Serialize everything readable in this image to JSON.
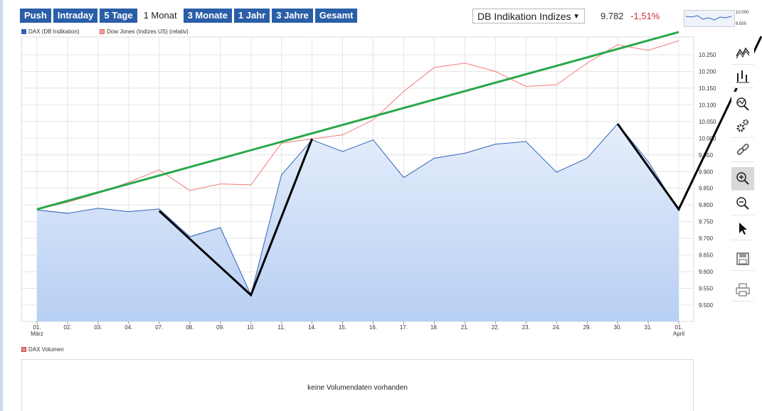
{
  "tabs": [
    {
      "label": "Push",
      "active": false
    },
    {
      "label": "Intraday",
      "active": false
    },
    {
      "label": "5 Tage",
      "active": false
    },
    {
      "label": "1 Monat",
      "active": true
    },
    {
      "label": "3 Monate",
      "active": false
    },
    {
      "label": "1 Jahr",
      "active": false
    },
    {
      "label": "3 Jahre",
      "active": false
    },
    {
      "label": "Gesamt",
      "active": false
    }
  ],
  "selector": {
    "value": "DB Indikation Indizes",
    "caret": "▼"
  },
  "quote": {
    "price": "9.782",
    "change": "-1,51%"
  },
  "minichart": {
    "high": "10.000",
    "low": "9.500"
  },
  "colors": {
    "accent": "#2a5ea8",
    "dax": "#2e62b8",
    "dow": "#f07a7a",
    "trend_green": "#2aa84a",
    "markup_black": "#000000"
  },
  "toolbar_icons": [
    "line-chart-icon",
    "ohlc-chart-icon",
    "indicator-icon",
    "settings-icon",
    "link-icon",
    "zoom-in-icon",
    "zoom-out-icon",
    "pointer-icon",
    "save-icon",
    "print-icon"
  ],
  "volume": {
    "legend": "DAX Volumen",
    "message": "keine Volumendaten vorhanden"
  },
  "chart_data": {
    "type": "area",
    "legend_placement": "top-left",
    "grid": true,
    "ylim": [
      9450,
      10300
    ],
    "yticks": [
      "9.500",
      "9.550",
      "9.600",
      "9.650",
      "9.700",
      "9.750",
      "9.800",
      "9.850",
      "9.900",
      "9.950",
      "10.000",
      "10.050",
      "10.100",
      "10.150",
      "10.200",
      "10.250"
    ],
    "yvals": [
      9500,
      9550,
      9600,
      9650,
      9700,
      9750,
      9800,
      9850,
      9900,
      9950,
      10000,
      10050,
      10100,
      10150,
      10200,
      10250
    ],
    "categories": [
      "01.",
      "02.",
      "03.",
      "04.",
      "07.",
      "08.",
      "09.",
      "10.",
      "11.",
      "14.",
      "15.",
      "16.",
      "17.",
      "18.",
      "21.",
      "22.",
      "23.",
      "24.",
      "29.",
      "30.",
      "31.",
      "01."
    ],
    "month_labels": {
      "0": "März",
      "21": "April"
    },
    "series": [
      {
        "name": "DAX (DB Indikation)",
        "values": [
          9785,
          9775,
          9790,
          9780,
          9788,
          9705,
          9732,
          9530,
          9890,
          9995,
          9960,
          9995,
          9882,
          9940,
          9955,
          9982,
          9990,
          9898,
          9940,
          10043,
          9930,
          9782
        ]
      },
      {
        "name": "Dow Jones (Indizes US) (relativ)",
        "values": [
          9787,
          9808,
          9835,
          9868,
          9905,
          9843,
          9863,
          9860,
          9985,
          9998,
          10010,
          10055,
          10140,
          10212,
          10225,
          10200,
          10155,
          10160,
          10225,
          10280,
          10263,
          10292
        ]
      }
    ],
    "annotations": {
      "green_trendline": [
        [
          0,
          9787
        ],
        [
          21,
          10318
        ]
      ],
      "black_lines": [
        [
          [
            4,
            9782
          ],
          [
            7,
            9530
          ],
          [
            9,
            9998
          ]
        ],
        [
          [
            19,
            10043
          ],
          [
            21,
            9787
          ],
          [
            23.7,
            10305
          ]
        ]
      ]
    }
  }
}
